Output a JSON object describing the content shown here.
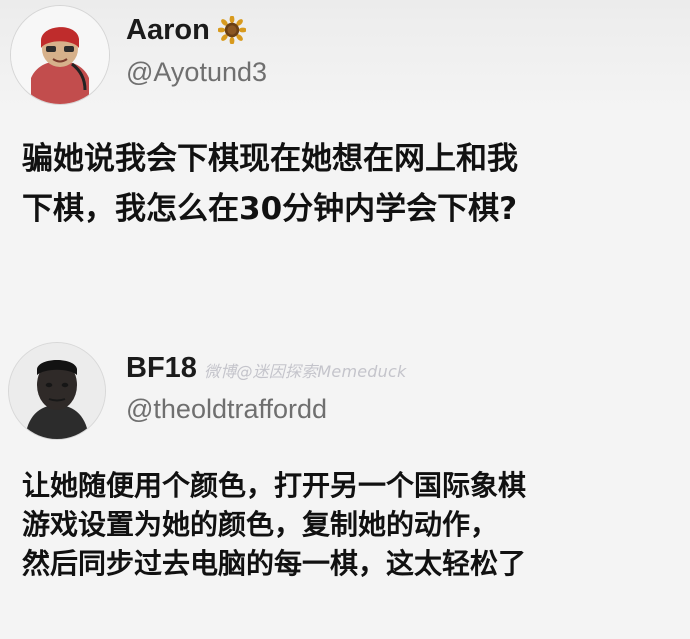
{
  "tweet_1": {
    "display_name": "Aaron",
    "handle": "@Ayotund3",
    "name_icon": "sunflower-icon",
    "text_lines": [
      "骗她说我会下棋现在她想在网上和我",
      "下棋，我怎么在30分钟内学会下棋?"
    ]
  },
  "tweet_2": {
    "display_name": "BF18",
    "handle": "@theoldtraffordd",
    "watermark": "微博@迷因探索Memeduck",
    "text_lines": [
      "让她随便用个颜色，打开另一个国际象棋",
      "游戏设置为她的颜色，复制她的动作，",
      "然后同步过去电脑的每一棋，这太轻松了"
    ]
  }
}
